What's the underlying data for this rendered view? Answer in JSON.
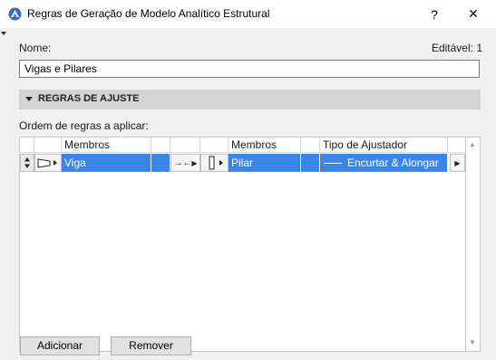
{
  "window": {
    "title": "Regras de Geração de Modelo Analítico Estrutural",
    "help_glyph": "?",
    "close_glyph": "✕"
  },
  "form": {
    "name_label": "Nome:",
    "editable_label": "Editável: 1",
    "name_value": "Vigas e Pilares"
  },
  "section": {
    "title": "REGRAS DE AJUSTE"
  },
  "rules": {
    "order_label": "Ordem de regras a aplicar:",
    "columns": {
      "members_a": "Membros",
      "members_b": "Membros",
      "adjuster_type": "Tipo de Ajustador"
    },
    "rows": [
      {
        "member_a": "Viga",
        "connector": "→←",
        "member_b": "Pilar",
        "adjuster": "Encurtar & Alongar"
      }
    ]
  },
  "buttons": {
    "add": "Adicionar",
    "remove": "Remover"
  }
}
